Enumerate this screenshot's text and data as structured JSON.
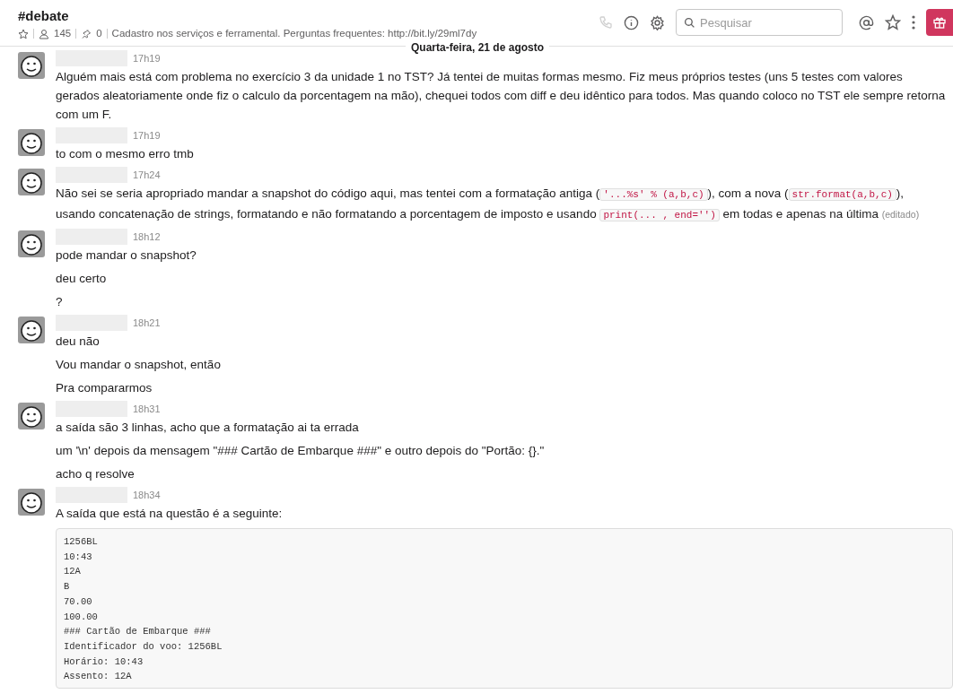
{
  "channel": {
    "name": "#debate",
    "members": "145",
    "pins": "0",
    "topic": "Cadastro nos serviços e ferramental. Perguntas frequentes: http://bit.ly/29ml7dy"
  },
  "search": {
    "placeholder": "Pesquisar"
  },
  "date_divider": "Quarta-feira, 21 de agosto",
  "messages": [
    {
      "time": "17h19",
      "lines": [
        [
          {
            "kind": "text",
            "text": "Alguém mais está com problema no exercício 3 da unidade 1 no TST? Já tentei de muitas formas mesmo. Fiz meus próprios testes (uns 5 testes com valores gerados aleatoriamente onde fiz o calculo da porcentagem na mão), chequei todos com diff e deu idêntico para todos. Mas quando coloco no TST ele sempre retorna com um F."
          }
        ]
      ]
    },
    {
      "time": "17h19",
      "lines": [
        [
          {
            "kind": "text",
            "text": "to com o mesmo erro tmb"
          }
        ]
      ]
    },
    {
      "time": "17h24",
      "lines": [
        [
          {
            "kind": "text",
            "text": "Não sei se seria apropriado mandar a snapshot do código aqui, mas tentei com a formatação antiga ("
          },
          {
            "kind": "code",
            "text": "'...%s' % (a,b,c)"
          },
          {
            "kind": "text",
            "text": "), com a nova ("
          },
          {
            "kind": "code",
            "text": "str.format(a,b,c)"
          },
          {
            "kind": "text",
            "text": "), usando concatenação de strings, formatando e não formatando a porcentagem de imposto e usando "
          },
          {
            "kind": "code",
            "text": "print(... , end='')"
          },
          {
            "kind": "text",
            "text": " em todas e apenas na última "
          },
          {
            "kind": "edited",
            "text": "(editado)"
          }
        ]
      ]
    },
    {
      "time": "18h12",
      "lines": [
        [
          {
            "kind": "text",
            "text": "pode mandar o snapshot?"
          }
        ],
        [
          {
            "kind": "text",
            "text": "deu certo"
          }
        ],
        [
          {
            "kind": "text",
            "text": "?"
          }
        ]
      ]
    },
    {
      "time": "18h21",
      "lines": [
        [
          {
            "kind": "text",
            "text": "deu não"
          }
        ],
        [
          {
            "kind": "text",
            "text": "Vou mandar o snapshot, então"
          }
        ],
        [
          {
            "kind": "text",
            "text": "Pra compararmos"
          }
        ]
      ]
    },
    {
      "time": "18h31",
      "lines": [
        [
          {
            "kind": "text",
            "text": "a saída são 3 linhas, acho que a formatação ai ta errada"
          }
        ],
        [
          {
            "kind": "text",
            "text": "um '\\n' depois da mensagem \"### Cartão de Embarque ###\" e outro depois do \"Portão: {}.\""
          }
        ],
        [
          {
            "kind": "text",
            "text": "acho q resolve"
          }
        ]
      ]
    },
    {
      "time": "18h34",
      "lines": [
        [
          {
            "kind": "text",
            "text": "A saída que está na questão é a seguinte:"
          }
        ]
      ],
      "code_block": [
        "1256BL",
        "10:43",
        "12A",
        "B",
        "70.00",
        "100.00",
        "### Cartão de Embarque ###",
        "Identificador do voo: 1256BL",
        "Horário: 10:43",
        "Assento: 12A"
      ]
    }
  ]
}
